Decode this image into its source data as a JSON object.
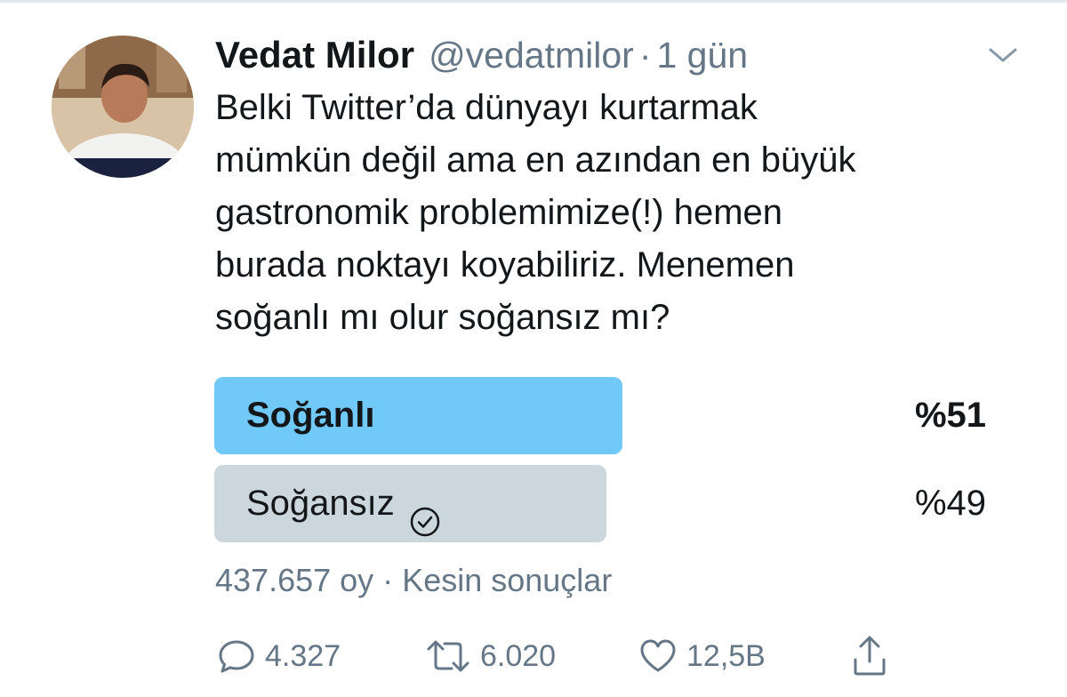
{
  "tweet": {
    "author_name": "Vedat Milor",
    "handle": "@vedatmilor",
    "separator": "·",
    "time": "1 gün",
    "text": "Belki Twitter’da dünyayı kurtarmak\nmümkün değil ama en azından en büyük\ngastronomik problemimize(!) hemen\nburada noktayı koyabiliriz. Menemen\nsoğanlı mı olur soğansız mı?"
  },
  "poll": {
    "options": [
      {
        "label": "Soğanlı",
        "percent_text": "%51",
        "percent": 51,
        "winner": true,
        "selected": false
      },
      {
        "label": "Soğansız",
        "percent_text": "%49",
        "percent": 49,
        "winner": false,
        "selected": true
      }
    ],
    "votes": "437.657 oy",
    "separator": "·",
    "status": "Kesin sonuçlar"
  },
  "actions": {
    "reply_count": "4.327",
    "retweet_count": "6.020",
    "like_count": "12,5B"
  },
  "icons": {
    "menu": "chevron-down-icon",
    "reply": "speech-bubble-icon",
    "retweet": "retweet-arrows-icon",
    "like": "heart-icon",
    "share": "share-upload-icon",
    "vote": "checkmark-circle-icon"
  },
  "colors": {
    "winner_bar": "#71c9f8",
    "other_bar": "#ccd6dd",
    "secondary_text": "#657786",
    "primary_text": "#14171a"
  }
}
